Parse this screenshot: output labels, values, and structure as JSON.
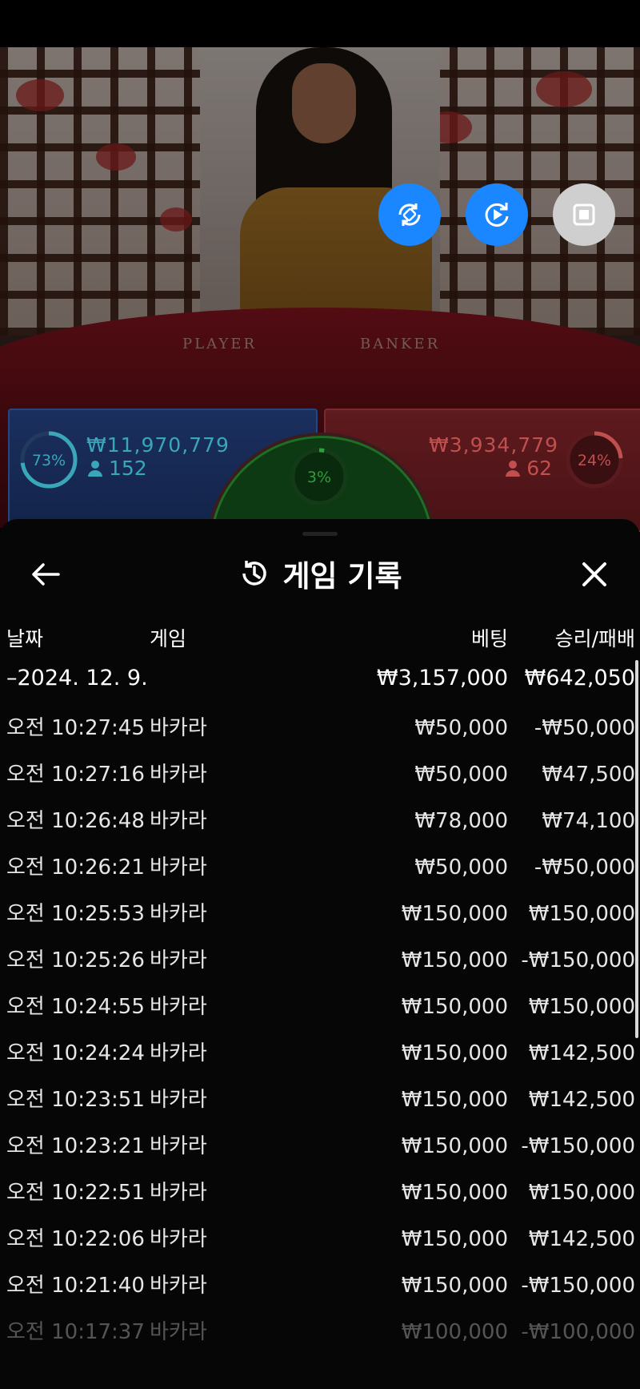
{
  "video": {
    "table_labels": {
      "player": "PLAYER",
      "banker": "BANKER"
    },
    "controls": [
      {
        "name": "rotate-screen-icon",
        "color": "#1a86ff"
      },
      {
        "name": "replay-icon",
        "color": "#1a86ff"
      },
      {
        "name": "stop-icon",
        "color": "#cfcfcf"
      }
    ]
  },
  "bets": {
    "player": {
      "percent": "73%",
      "percent_value": 0.73,
      "amount": "₩11,970,779",
      "count": "152",
      "color": "#3aa6b9"
    },
    "tie": {
      "percent": "3%",
      "percent_value": 0.03,
      "color": "#2e9e3a"
    },
    "banker": {
      "percent": "24%",
      "percent_value": 0.24,
      "amount": "₩3,934,779",
      "count": "62",
      "color": "#c0504d"
    }
  },
  "sheet": {
    "title": "게임 기록",
    "columns": {
      "date": "날짜",
      "game": "게임",
      "bet": "베팅",
      "result": "승리/패배"
    },
    "summary": {
      "date": "–2024. 12. 9.",
      "bet": "₩3,157,000",
      "result": "₩642,050"
    },
    "rows": [
      {
        "time": "오전 10:27:45",
        "game": "바카라",
        "bet": "₩50,000",
        "result": "-₩50,000"
      },
      {
        "time": "오전 10:27:16",
        "game": "바카라",
        "bet": "₩50,000",
        "result": "₩47,500"
      },
      {
        "time": "오전 10:26:48",
        "game": "바카라",
        "bet": "₩78,000",
        "result": "₩74,100"
      },
      {
        "time": "오전 10:26:21",
        "game": "바카라",
        "bet": "₩50,000",
        "result": "-₩50,000"
      },
      {
        "time": "오전 10:25:53",
        "game": "바카라",
        "bet": "₩150,000",
        "result": "₩150,000"
      },
      {
        "time": "오전 10:25:26",
        "game": "바카라",
        "bet": "₩150,000",
        "result": "-₩150,000"
      },
      {
        "time": "오전 10:24:55",
        "game": "바카라",
        "bet": "₩150,000",
        "result": "₩150,000"
      },
      {
        "time": "오전 10:24:24",
        "game": "바카라",
        "bet": "₩150,000",
        "result": "₩142,500"
      },
      {
        "time": "오전 10:23:51",
        "game": "바카라",
        "bet": "₩150,000",
        "result": "₩142,500"
      },
      {
        "time": "오전 10:23:21",
        "game": "바카라",
        "bet": "₩150,000",
        "result": "-₩150,000"
      },
      {
        "time": "오전 10:22:51",
        "game": "바카라",
        "bet": "₩150,000",
        "result": "₩150,000"
      },
      {
        "time": "오전 10:22:06",
        "game": "바카라",
        "bet": "₩150,000",
        "result": "₩142,500"
      },
      {
        "time": "오전 10:21:40",
        "game": "바카라",
        "bet": "₩150,000",
        "result": "-₩150,000"
      },
      {
        "time": "오전 10:17:37",
        "game": "바카라",
        "bet": "₩100,000",
        "result": "-₩100,000"
      }
    ]
  }
}
